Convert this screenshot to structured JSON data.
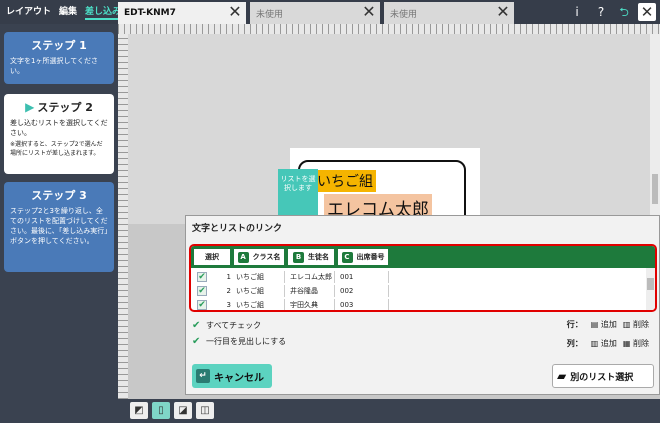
{
  "menu": {
    "layout": "レイアウト",
    "edit": "編集",
    "merge": "差し込み"
  },
  "tabs": [
    {
      "label": "EDT-KNM7"
    },
    {
      "label": "未使用"
    },
    {
      "label": "未使用"
    }
  ],
  "toolbar": {
    "info": "i",
    "help": "?",
    "undo": "⮌",
    "close": "✕"
  },
  "steps": {
    "s1": {
      "title": "ステップ 1",
      "text": "文字を1ヶ所選択してください。"
    },
    "s2": {
      "title": "ステップ 2",
      "text": "差し込むリストを選択してください。",
      "note": "※選択すると、ステップ2で選んだ場所にリストが差し込まれます。"
    },
    "s3": {
      "title": "ステップ 3",
      "text": "ステップ2と3を繰り返し、全てのリストを配置づけしてください。最後に、「差し込み実行」ボタンを押してください。"
    }
  },
  "canvas": {
    "tag1": "いちご組",
    "tag2": "エレコム太郎",
    "callout": "リストを選択します"
  },
  "dialog": {
    "title": "文字とリストのリンク",
    "headers": {
      "select": "選択",
      "col_a": {
        "badge": "A",
        "label": "クラス名"
      },
      "col_b": {
        "badge": "B",
        "label": "生徒名"
      },
      "col_c": {
        "badge": "C",
        "label": "出席番号"
      }
    },
    "rows": [
      {
        "num": "1",
        "a": "いちご組",
        "b": "エレコム太郎",
        "c": "001"
      },
      {
        "num": "2",
        "a": "いちご組",
        "b": "井谷隆晶",
        "c": "002"
      },
      {
        "num": "3",
        "a": "いちご組",
        "b": "宇田久典",
        "c": "003"
      }
    ],
    "check_all": "すべてチェック",
    "header_row": "一行目を見出しにする",
    "row_label": "行：",
    "col_label": "列：",
    "add": "追加",
    "delete": "削除",
    "cancel": "キャンセル",
    "other_list": "別のリスト選択"
  }
}
